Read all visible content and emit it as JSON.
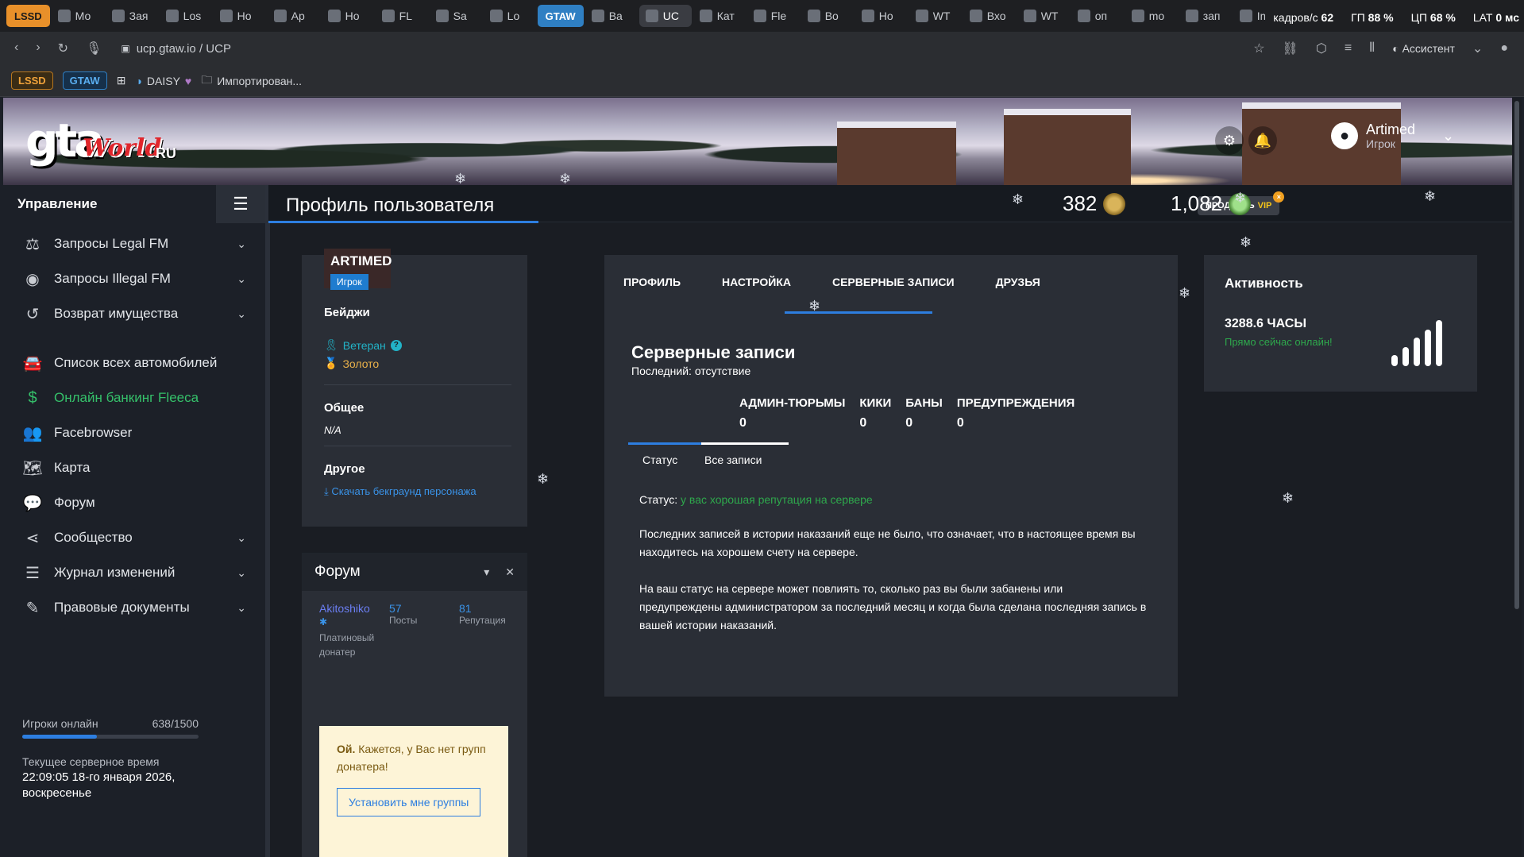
{
  "browser": {
    "tabs": [
      {
        "label": "LSSD",
        "kind": "lssd"
      },
      {
        "label": "Мо",
        "kind": "tab"
      },
      {
        "label": "Зая",
        "kind": "tab"
      },
      {
        "label": "Los",
        "kind": "tab"
      },
      {
        "label": "Ho",
        "kind": "tab"
      },
      {
        "label": "Ap",
        "kind": "tab"
      },
      {
        "label": "Ho",
        "kind": "tab"
      },
      {
        "label": "FL",
        "kind": "tab"
      },
      {
        "label": "Sa",
        "kind": "tab"
      },
      {
        "label": "Lo",
        "kind": "tab"
      },
      {
        "label": "GTAW",
        "kind": "gtaw"
      },
      {
        "label": "Ba",
        "kind": "tab"
      },
      {
        "label": "UC",
        "kind": "active"
      },
      {
        "label": "Кат",
        "kind": "tab"
      },
      {
        "label": "Fle",
        "kind": "tab"
      },
      {
        "label": "Bo",
        "kind": "tab"
      },
      {
        "label": "Ho",
        "kind": "tab"
      },
      {
        "label": "WT",
        "kind": "tab"
      },
      {
        "label": "Вхо",
        "kind": "tab"
      },
      {
        "label": "WT",
        "kind": "tab"
      },
      {
        "label": "оп",
        "kind": "tab"
      },
      {
        "label": "mo",
        "kind": "tab"
      },
      {
        "label": "зап",
        "kind": "tab"
      },
      {
        "label": "Im",
        "kind": "tab"
      }
    ],
    "stats": {
      "fps_label": "кадров/с",
      "fps_value": "62",
      "gpu_label": "ГП",
      "gpu_value": "88 %",
      "cpu_label": "ЦП",
      "cpu_value": "68 %",
      "lat_label": "LAT",
      "lat_value": "0 мс"
    },
    "url": "ucp.gtaw.io / UCP",
    "assistant_label": "Ассистент",
    "bookmarks": {
      "lssd": "LSSD",
      "gtaw": "GTAW",
      "daisy": "DAISY",
      "imported": "Импортирован..."
    }
  },
  "header": {
    "logo": {
      "gta": "gta",
      "world": "World",
      "ru": "RU"
    },
    "user_name": "Artimed",
    "user_role": "Игрок"
  },
  "sidebar": {
    "title": "Управление",
    "items": [
      {
        "label": "Запросы Legal FM",
        "icon": "scales-icon",
        "glyph": "⚖",
        "chevron": true
      },
      {
        "label": "Запросы Illegal FM",
        "icon": "mask-icon",
        "glyph": "◉",
        "chevron": true
      },
      {
        "label": "Возврат имущества",
        "icon": "undo-icon",
        "glyph": "↺",
        "chevron": true
      },
      {
        "label": "Список всех автомобилей",
        "icon": "car-icon",
        "glyph": "🚘",
        "chevron": false
      },
      {
        "label": "Онлайн банкинг Fleeca",
        "icon": "money-icon",
        "glyph": "$",
        "chevron": false
      },
      {
        "label": "Facebrowser",
        "icon": "users-icon",
        "glyph": "👥",
        "chevron": false
      },
      {
        "label": "Карта",
        "icon": "map-icon",
        "glyph": "🗺",
        "chevron": false
      },
      {
        "label": "Форум",
        "icon": "comments-icon",
        "glyph": "💬",
        "chevron": false
      },
      {
        "label": "Сообщество",
        "icon": "share-icon",
        "glyph": "⋖",
        "chevron": true
      },
      {
        "label": "Журнал изменений",
        "icon": "list-icon",
        "glyph": "☰",
        "chevron": true
      },
      {
        "label": "Правовые документы",
        "icon": "document-icon",
        "glyph": "✎",
        "chevron": true
      }
    ],
    "online_label": "Игроки онлайн",
    "online_value": "638/1500",
    "online_fraction": 0.425,
    "server_time_label": "Текущее серверное время",
    "server_time_value": "22:09:05 18-го января 2026,",
    "server_time_day": "воскресенье"
  },
  "content": {
    "page_title": "Профиль пользователя",
    "vip_prefix": "ПРОДЛИТЬ",
    "vip_word": "VIP",
    "vip_close": "×",
    "coins": "382",
    "gc": "1,082"
  },
  "profile": {
    "name": "ARTIMED",
    "role": "Игрок",
    "badges_title": "Бейджи",
    "badge_veteran": "Ветеран",
    "badge_gold": "Золото",
    "general_title": "Общее",
    "general_value": "N/A",
    "other_title": "Другое",
    "download_link": "Скачать бекграунд персонажа"
  },
  "forum": {
    "title": "Форум",
    "user": "Akitoshiko",
    "posts_value": "57",
    "posts_label": "Посты",
    "rep_value": "81",
    "rep_label": "Репутация",
    "rank_line1": "Платиновый",
    "rank_line2": "донатер",
    "donor_bold": "Ой.",
    "donor_text": "Кажется, у Вас нет групп донатера!",
    "donor_button": "Установить мне группы"
  },
  "main": {
    "tabs": [
      "ПРОФИЛЬ",
      "НАСТРОЙКА",
      "СЕРВЕРНЫЕ ЗАПИСИ",
      "ДРУЗЬЯ"
    ],
    "title": "Серверные записи",
    "last": "Последний: отсутствие",
    "counts": [
      {
        "label": "АДМИН-ТЮРЬМЫ",
        "value": "0"
      },
      {
        "label": "КИКИ",
        "value": "0"
      },
      {
        "label": "БАНЫ",
        "value": "0"
      },
      {
        "label": "ПРЕДУПРЕЖДЕНИЯ",
        "value": "0"
      }
    ],
    "subtab_status": "Статус",
    "subtab_all": "Все записи",
    "status_label": "Статус:",
    "status_value": "у вас хорошая репутация на сервере",
    "para1": "Последних записей в истории наказаний еще не было, что означает, что в настоящее время вы находитесь на хорошем счету на сервере.",
    "para2": "На ваш статус на сервере может повлиять то, сколько раз вы были забанены или предупреждены администратором за последний месяц и когда была сделана последняя запись в вашей истории наказаний."
  },
  "activity": {
    "title": "Активность",
    "hours": "3288.6 ЧАСЫ",
    "online_now": "Прямо сейчас онлайн!"
  },
  "colors": {
    "accent": "#2d7ee0",
    "good": "#2ea84c",
    "lssd": "#e8902a",
    "gtaw": "#2f7fc3"
  }
}
